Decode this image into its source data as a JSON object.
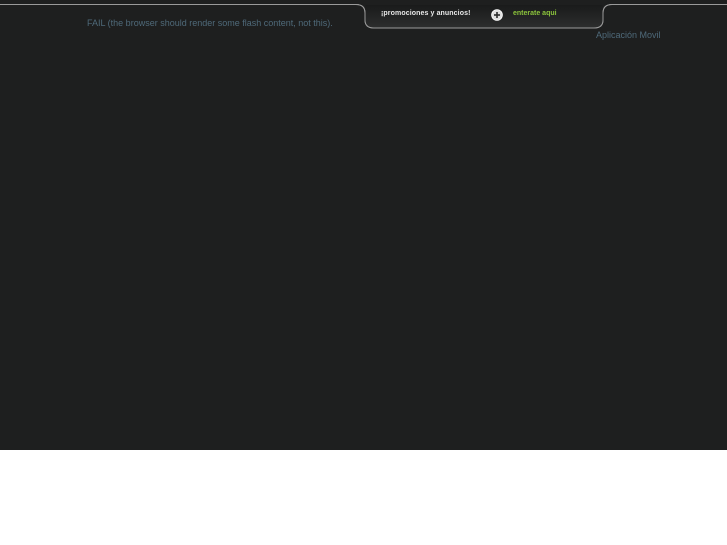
{
  "flash_placeholder": {
    "message": "FAIL (the browser should render some flash content, not this)."
  },
  "promo_bar": {
    "text": "¡promociones y anuncios!",
    "icon": "plus-circle-icon",
    "link_label": "enterate aqui",
    "link_color": "#8cc43c"
  },
  "header": {
    "mobile_app_link": "Aplicación Movil"
  },
  "colors": {
    "background_dark": "#1e1f1f",
    "muted_text": "#4f6a7a"
  }
}
